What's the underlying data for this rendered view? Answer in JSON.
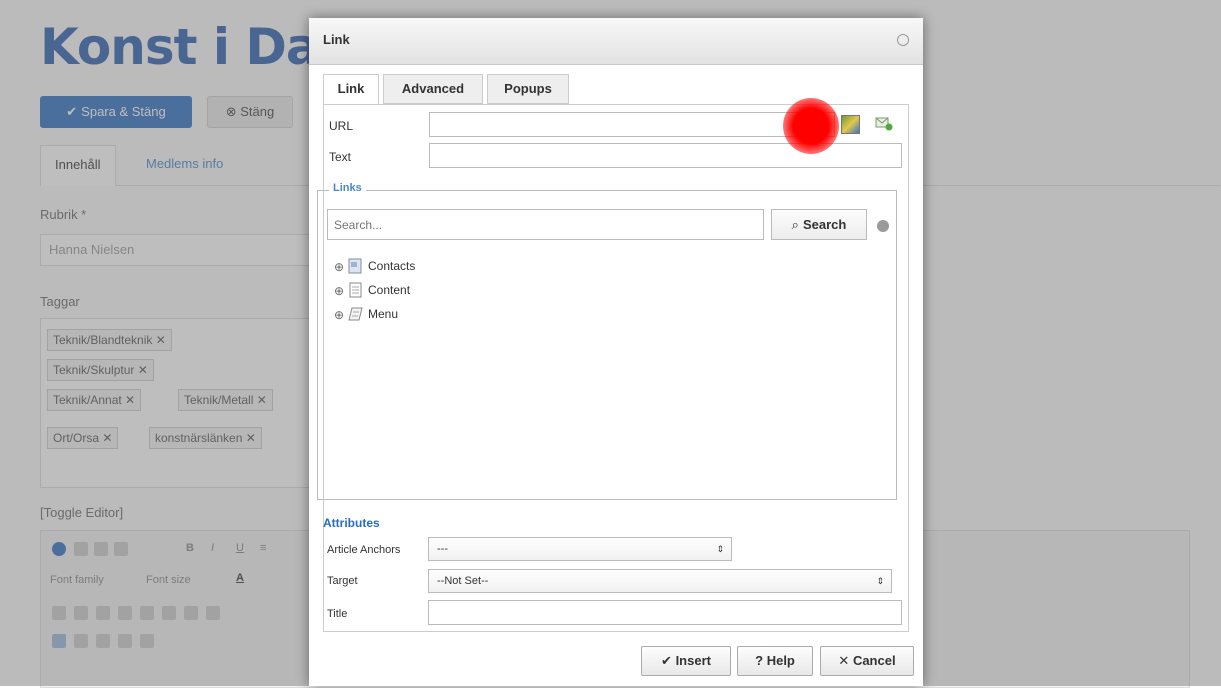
{
  "background": {
    "title": "Konst i Dala",
    "save_close_label": "Spara & Stäng",
    "close_label": "Stäng",
    "tabs": [
      "Innehåll",
      "Medlems info"
    ],
    "rubrik_label": "Rubrik *",
    "rubrik_value": "Hanna Nielsen",
    "tags_label": "Taggar",
    "tags": [
      "Teknik/Blandteknik",
      "Teknik/Skulptur",
      "Teknik/Annat",
      "Teknik/Metall",
      "Ort/Orsa",
      "konstnärslänken"
    ],
    "toggle_editor": "[Toggle Editor]",
    "font_family": "Font family",
    "font_size": "Font size"
  },
  "dialog": {
    "title": "Link",
    "tabs": [
      "Link",
      "Advanced",
      "Popups"
    ],
    "url_label": "URL",
    "url_value": "",
    "text_label": "Text",
    "text_value": "",
    "links_legend": "Links",
    "search_placeholder": "Search...",
    "search_button": "Search",
    "tree": [
      {
        "label": "Contacts",
        "icon": "contacts-icon"
      },
      {
        "label": "Content",
        "icon": "content-icon"
      },
      {
        "label": "Menu",
        "icon": "menu-icon"
      }
    ],
    "attributes_title": "Attributes",
    "article_anchors_label": "Article Anchors",
    "article_anchors_value": "---",
    "target_label": "Target",
    "target_value": "--Not Set--",
    "title_label": "Title",
    "title_value": "",
    "insert_label": "Insert",
    "help_label": "Help",
    "cancel_label": "Cancel"
  }
}
